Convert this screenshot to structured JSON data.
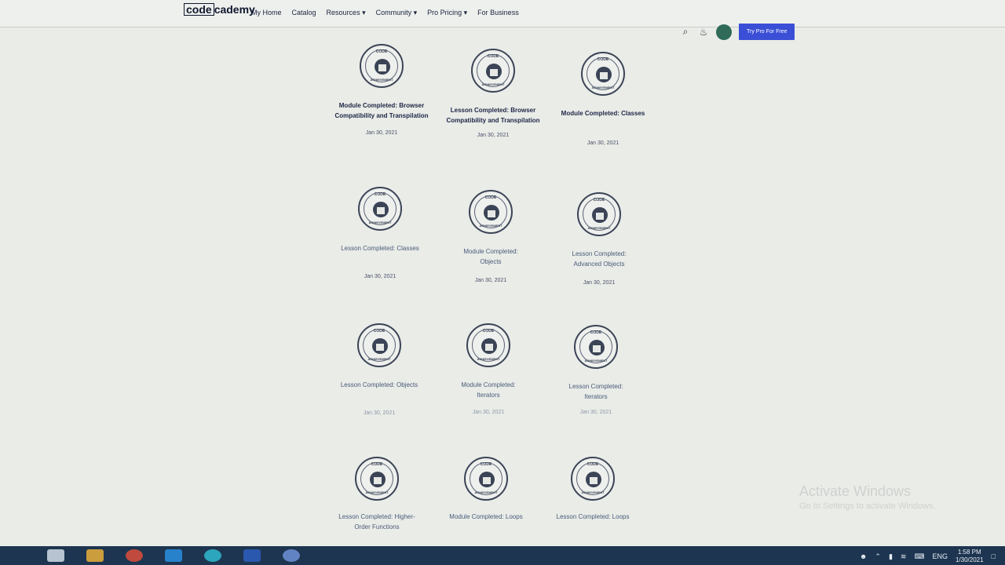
{
  "browser": {
    "icons": [
      "search-icon",
      "star-icon",
      "extension-icon",
      "pinterest-icon",
      "grammarly-icon",
      "puzzle-icon"
    ]
  },
  "nav": {
    "logo_box": "code",
    "logo_rest": "cademy",
    "links": [
      "My Home",
      "Catalog",
      "Resources ▾",
      "Community ▾",
      "Pro Pricing ▾",
      "For Business"
    ],
    "search_icon": "⌕",
    "bell_icon": "🔔",
    "cta_label": "Try Pro For Free"
  },
  "badge": {
    "top_text": "CODE",
    "bottom_text": "ACHIEVEMENT"
  },
  "achievements": [
    {
      "title": "Module Completed: Browser Compatibility and Transpilation",
      "date": "Jan 30, 2021"
    },
    {
      "title": "Lesson Completed: Browser Compatibility and Transpilation",
      "date": "Jan 30, 2021"
    },
    {
      "title": "Module Completed: Classes",
      "date": "Jan 30, 2021"
    },
    {
      "title": "Lesson Completed: Classes",
      "date": "Jan 30, 2021"
    },
    {
      "title": "Module Completed: Objects",
      "date": "Jan 30, 2021"
    },
    {
      "title": "Lesson Completed: Advanced Objects",
      "date": "Jan 30, 2021"
    },
    {
      "title": "Lesson Completed: Objects",
      "date": "Jan 30, 2021"
    },
    {
      "title": "Module Completed: Iterators",
      "date": "Jan 30, 2021"
    },
    {
      "title": "Lesson Completed: Iterators",
      "date": "Jan 30, 2021"
    },
    {
      "title": "Lesson Completed: Higher-Order Functions",
      "date": ""
    },
    {
      "title": "Module Completed: Loops",
      "date": ""
    },
    {
      "title": "Lesson Completed: Loops",
      "date": ""
    }
  ],
  "watermark": {
    "line1": "Activate Windows",
    "line2": "Go to Settings to activate Windows."
  },
  "taskbar": {
    "language": "ENG",
    "time": "1:58 PM",
    "date": "1/30/2021"
  }
}
